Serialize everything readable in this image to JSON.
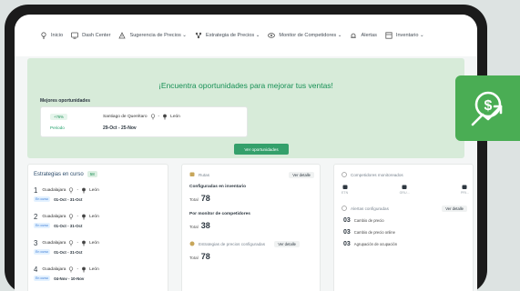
{
  "nav": [
    {
      "label": "Inicio",
      "icon": "bulb-icon"
    },
    {
      "label": "Dash Center",
      "icon": "dashboard-icon"
    },
    {
      "label": "Sugerencia de Precios ⌄",
      "icon": "price-suggestion-icon"
    },
    {
      "label": "Estrategia de Precios ⌄",
      "icon": "strategy-icon"
    },
    {
      "label": "Monitor de Competidores ⌄",
      "icon": "monitor-icon"
    },
    {
      "label": "Alertas",
      "icon": "alert-icon"
    },
    {
      "label": "Inventario ⌄",
      "icon": "inventory-icon"
    }
  ],
  "hero": {
    "title": "¡Encuentra oportunidades para mejorar tus ventas!",
    "best_label": "Mejores oportunidades",
    "pill": "+76%",
    "period_label": "Periodo",
    "origin": "Santiago de Querétaro",
    "destination": "León",
    "period_value": "29-Oct - 25-Nov",
    "button": "Ver oportunidades"
  },
  "strategies": {
    "title": "Estrategias en curso",
    "count": "58",
    "rows": [
      {
        "num": "1",
        "origin": "Guadalajara",
        "destination": "León",
        "tag": "En curso",
        "dates": "01-Oct - 31-Oct"
      },
      {
        "num": "2",
        "origin": "Guadalajara",
        "destination": "León",
        "tag": "En curso",
        "dates": "01-Oct - 31-Oct"
      },
      {
        "num": "3",
        "origin": "Guadalajara",
        "destination": "León",
        "tag": "En curso",
        "dates": "01-Oct - 31-Oct"
      },
      {
        "num": "4",
        "origin": "Guadalajara",
        "destination": "León",
        "tag": "En curso",
        "dates": "04-Nov - 10-Nov"
      }
    ]
  },
  "routes": {
    "title": "Rutas",
    "detail": "Ver detalle",
    "inv_label": "Configuradas en inventario",
    "inv_total_label": "Total",
    "inv_total": "78",
    "monitor_label": "Por monitor de competidores",
    "monitor_total_label": "Total",
    "monitor_total": "38",
    "strat_title": "Estrategias de precios configuradas",
    "strat_detail": "Ver detalle",
    "strat_total_label": "Total",
    "strat_total": "78"
  },
  "competitors": {
    "title": "Competidores monitoreados",
    "items": [
      "ETN",
      "GRU...",
      "PRI..."
    ]
  },
  "alerts": {
    "title": "Alertas configuradas",
    "detail": "Ver detalle",
    "items": [
      {
        "count": "03",
        "label": "Cambio de precio"
      },
      {
        "count": "03",
        "label": "Cambio de precio online"
      },
      {
        "count": "03",
        "label": "Agrupación de ocupación"
      }
    ]
  },
  "colors": {
    "brand_green": "#34a06b",
    "hero_bg": "#d7ebd9",
    "fab_green": "#4aad54"
  }
}
